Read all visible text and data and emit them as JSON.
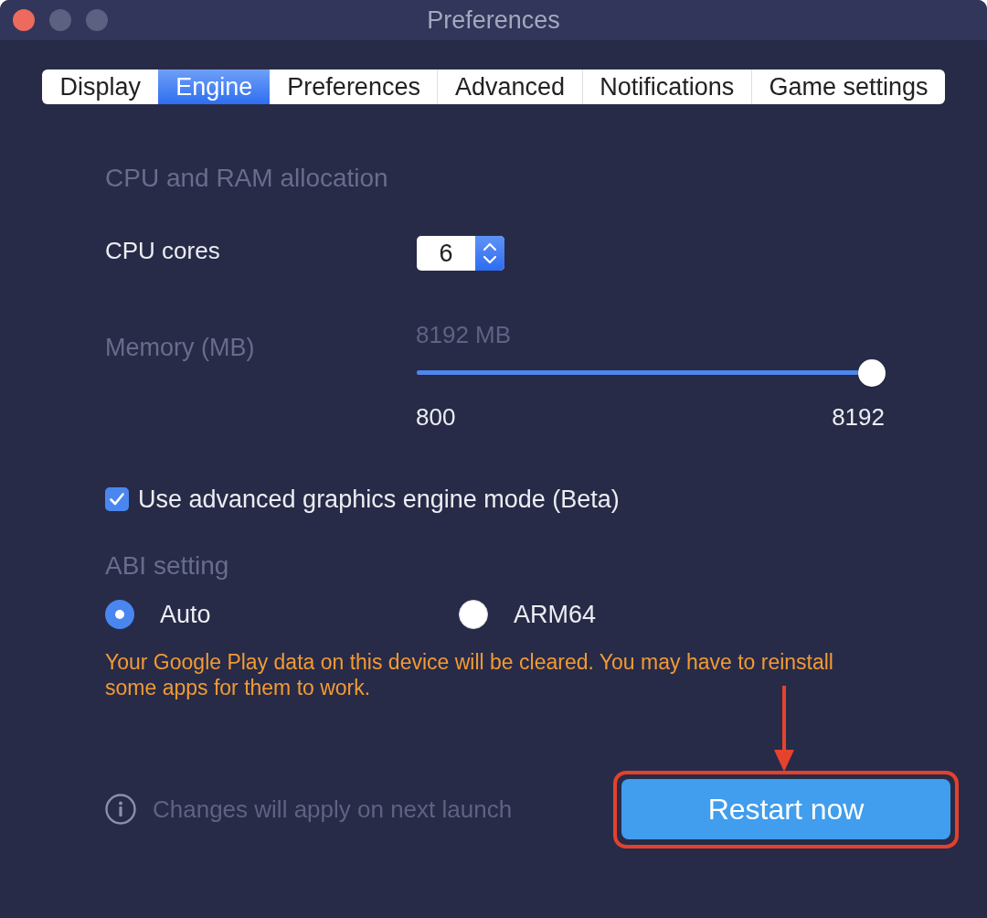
{
  "window": {
    "title": "Preferences"
  },
  "tabs": [
    {
      "label": "Display",
      "selected": false
    },
    {
      "label": "Engine",
      "selected": true
    },
    {
      "label": "Preferences",
      "selected": false
    },
    {
      "label": "Advanced",
      "selected": false
    },
    {
      "label": "Notifications",
      "selected": false
    },
    {
      "label": "Game settings",
      "selected": false
    }
  ],
  "allocation": {
    "heading": "CPU and RAM allocation",
    "cpu_cores": {
      "label": "CPU cores",
      "value": "6"
    },
    "memory": {
      "label": "Memory (MB)",
      "reading": "8192 MB",
      "min_label": "800",
      "max_label": "8192",
      "level": 1
    }
  },
  "graphics_option": {
    "label": "Use advanced graphics engine mode (Beta)",
    "checked": true
  },
  "abi": {
    "heading": "ABI setting",
    "options": [
      {
        "label": "Auto",
        "selected": true
      },
      {
        "label": "ARM64",
        "selected": false
      }
    ],
    "warning": "Your Google Play data on this device will be cleared. You may have to reinstall some apps for them to work."
  },
  "footer": {
    "note": "Changes will apply on next launch",
    "restart_button": {
      "label": "Restart now",
      "highlighted": true
    }
  }
}
